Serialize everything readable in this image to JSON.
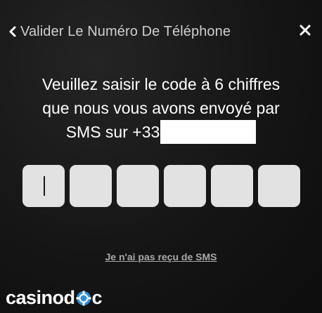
{
  "header": {
    "back_icon": "chevron-left-icon",
    "title": "Valider Le Numéro De Téléphone",
    "close_icon": "close-icon"
  },
  "instruction": {
    "line1": "Veuillez saisir le code à 6 chiffres",
    "line2": "que nous vous avons envoyé par",
    "line3_prefix": "SMS sur +33"
  },
  "code_inputs": {
    "count": 6,
    "values": [
      "",
      "",
      "",
      "",
      "",
      ""
    ],
    "active_index": 0
  },
  "resend_link": {
    "label": "Je n'ai pas reçu de SMS"
  },
  "watermark": {
    "text_before": "casinod",
    "text_after": "c",
    "accent_color": "#2f8fd8"
  },
  "colors": {
    "background": "#151515",
    "input_fill": "#e2e2e2",
    "title_text": "#cfcfcf",
    "link_text": "#a9a9a9"
  }
}
